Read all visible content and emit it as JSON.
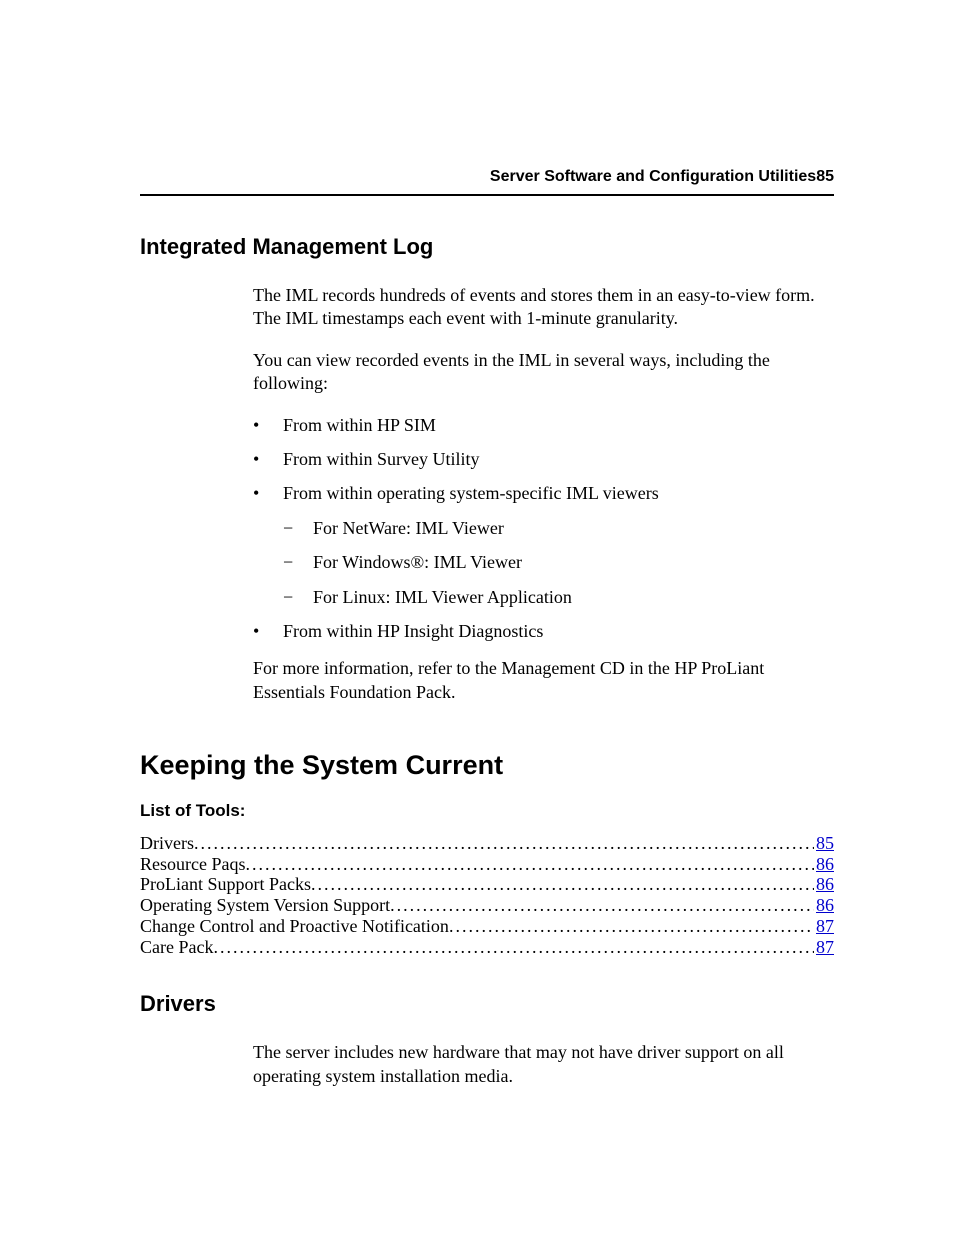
{
  "header": {
    "title": "Server Software and Configuration Utilities",
    "page_number": "85"
  },
  "section1": {
    "title": "Integrated Management Log",
    "para1": "The IML records hundreds of events and stores them in an easy-to-view form. The IML timestamps each event with 1-minute granularity.",
    "para2": "You can view recorded events in the IML in several ways, including the following:",
    "bullets": [
      "From within HP SIM",
      "From within Survey Utility",
      "From within operating system-specific IML viewers",
      "From within HP Insight Diagnostics"
    ],
    "subbullets": [
      "For NetWare: IML Viewer",
      "For Windows®: IML Viewer",
      "For Linux: IML Viewer Application"
    ],
    "para3": "For more information, refer to the Management CD in the HP ProLiant Essentials Foundation Pack."
  },
  "section2": {
    "title": "Keeping the System Current",
    "subtitle": "List of Tools:",
    "toc": [
      {
        "label": "Drivers",
        "page": "85"
      },
      {
        "label": "Resource Paqs",
        "page": "86"
      },
      {
        "label": "ProLiant Support Packs",
        "page": "86"
      },
      {
        "label": "Operating System Version Support",
        "page": "86"
      },
      {
        "label": "Change Control and Proactive Notification",
        "page": "87"
      },
      {
        "label": "Care Pack",
        "page": "87"
      }
    ]
  },
  "section3": {
    "title": "Drivers",
    "para1": "The server includes new hardware that may not have driver support on all operating system installation media."
  }
}
